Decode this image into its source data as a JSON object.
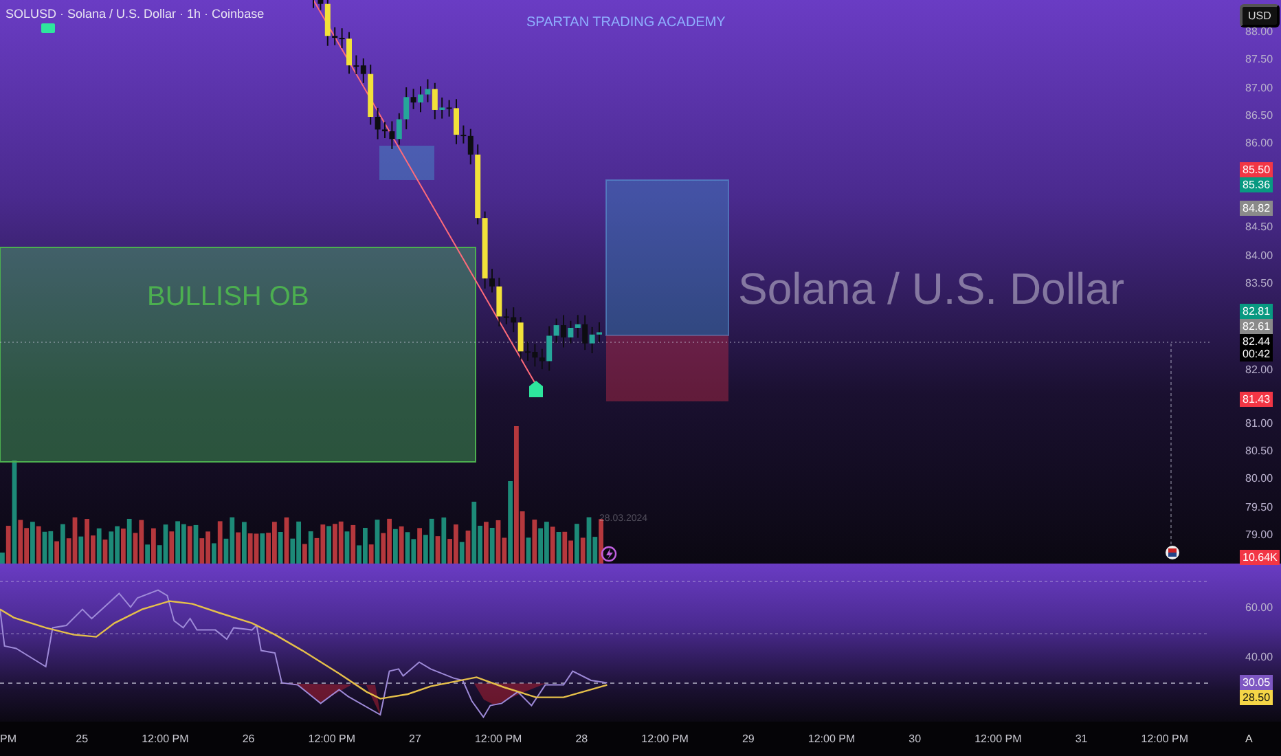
{
  "header": {
    "title": "SOLUSD · Solana / U.S. Dollar · 1h · Coinbase",
    "watermark": "SPARTAN TRADING ACADEMY",
    "symbol_watermark": "Solana / U.S. Dollar"
  },
  "zone": {
    "label": "BULLISH OB"
  },
  "note": {
    "date": "28.03.2024"
  },
  "price_axis": {
    "currency": "USD",
    "ticks": [
      "88.00",
      "87.50",
      "87.00",
      "86.50",
      "86.00",
      "84.50",
      "84.00",
      "83.50",
      "82.00",
      "81.00",
      "80.50",
      "80.00",
      "79.50",
      "79.00"
    ],
    "badges": [
      {
        "label": "85.50",
        "color": "#f23645"
      },
      {
        "label": "85.36",
        "color": "#089981"
      },
      {
        "label": "84.82",
        "color": "#8a8a8a"
      },
      {
        "label": "82.81",
        "color": "#089981"
      },
      {
        "label": "82.61",
        "color": "#8a8a8a"
      },
      {
        "label": "82.44",
        "sublabel": "00:42",
        "color": "#000000"
      },
      {
        "label": "81.43",
        "color": "#f23645"
      },
      {
        "label": "10.64K",
        "color": "#f23645"
      }
    ]
  },
  "rsi_axis": {
    "ticks": [
      "60.00",
      "40.00"
    ],
    "badges": [
      {
        "label": "30.05",
        "color": "#7e57c2"
      },
      {
        "label": "28.50",
        "color": "#f5d547"
      }
    ]
  },
  "time_axis": {
    "labels": [
      "PM",
      "25",
      "12:00 PM",
      "26",
      "12:00 PM",
      "27",
      "12:00 PM",
      "28",
      "12:00 PM",
      "29",
      "12:00 PM",
      "30",
      "12:00 PM",
      "31",
      "12:00 PM"
    ],
    "auto_button": "A"
  }
}
